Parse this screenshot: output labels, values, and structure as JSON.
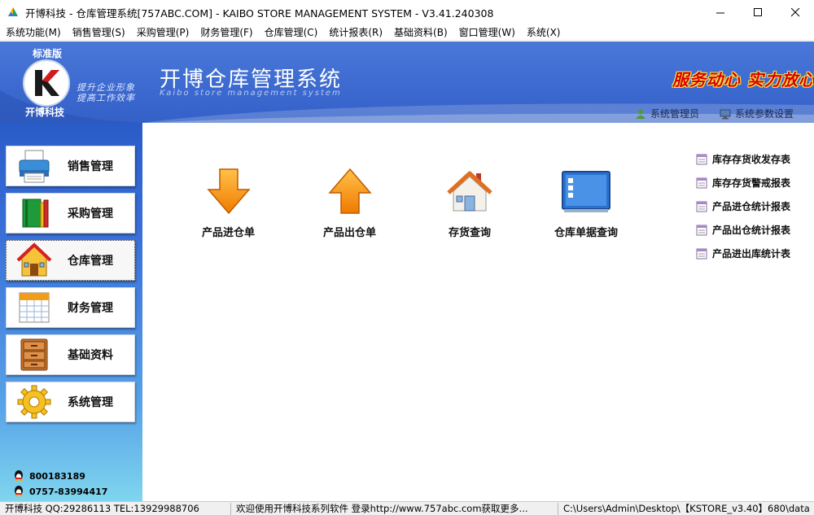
{
  "window": {
    "title": "开博科技 - 仓库管理系统[757ABC.COM] - KAIBO STORE MANAGEMENT SYSTEM - V3.41.240308"
  },
  "menu": [
    "系统功能(M)",
    "销售管理(S)",
    "采购管理(P)",
    "财务管理(F)",
    "仓库管理(C)",
    "统计报表(R)",
    "基础资料(B)",
    "窗口管理(W)",
    "系统(X)"
  ],
  "header": {
    "edition": "标准版",
    "company": "开博科技",
    "slogan_line1": "提升企业形象",
    "slogan_line2": "提高工作效率",
    "system_title": "开博仓库管理系统",
    "system_subtitle": "Kaibo store management system",
    "motto": "服务动心 实力放心",
    "user_label": "系统管理员",
    "settings_label": "系统参数设置"
  },
  "sidebar": {
    "items": [
      {
        "label": "销售管理",
        "icon": "printer-icon"
      },
      {
        "label": "采购管理",
        "icon": "books-icon"
      },
      {
        "label": "仓库管理",
        "icon": "warehouse-house-icon"
      },
      {
        "label": "财务管理",
        "icon": "calendar-icon"
      },
      {
        "label": "基础资料",
        "icon": "cabinet-icon"
      },
      {
        "label": "系统管理",
        "icon": "gear-icon"
      }
    ],
    "active_index": 2,
    "contact_qq": "800183189",
    "contact_phone": "0757-83994417"
  },
  "main": {
    "functions": [
      {
        "label": "产品进仓单",
        "icon": "arrow-down-icon"
      },
      {
        "label": "产品出仓单",
        "icon": "arrow-up-icon"
      },
      {
        "label": "存货查询",
        "icon": "home-icon"
      },
      {
        "label": "仓库单据查询",
        "icon": "window-list-icon"
      }
    ],
    "reports": [
      "库存存货收发存表",
      "库存存货警戒报表",
      "产品进仓统计报表",
      "产品出仓统计报表",
      "产品进出库统计表"
    ]
  },
  "statusbar": {
    "left": "开博科技 QQ:29286113 TEL:13929988706",
    "middle": "欢迎使用开博科技系列软件  登录http://www.757abc.com获取更多...",
    "right": "C:\\Users\\Admin\\Desktop\\【KSTORE_v3.40】680\\data"
  },
  "colors": {
    "banner_blue": "#3c69cf",
    "motto_red": "#d40000",
    "arrow_orange": "#f28c00"
  }
}
